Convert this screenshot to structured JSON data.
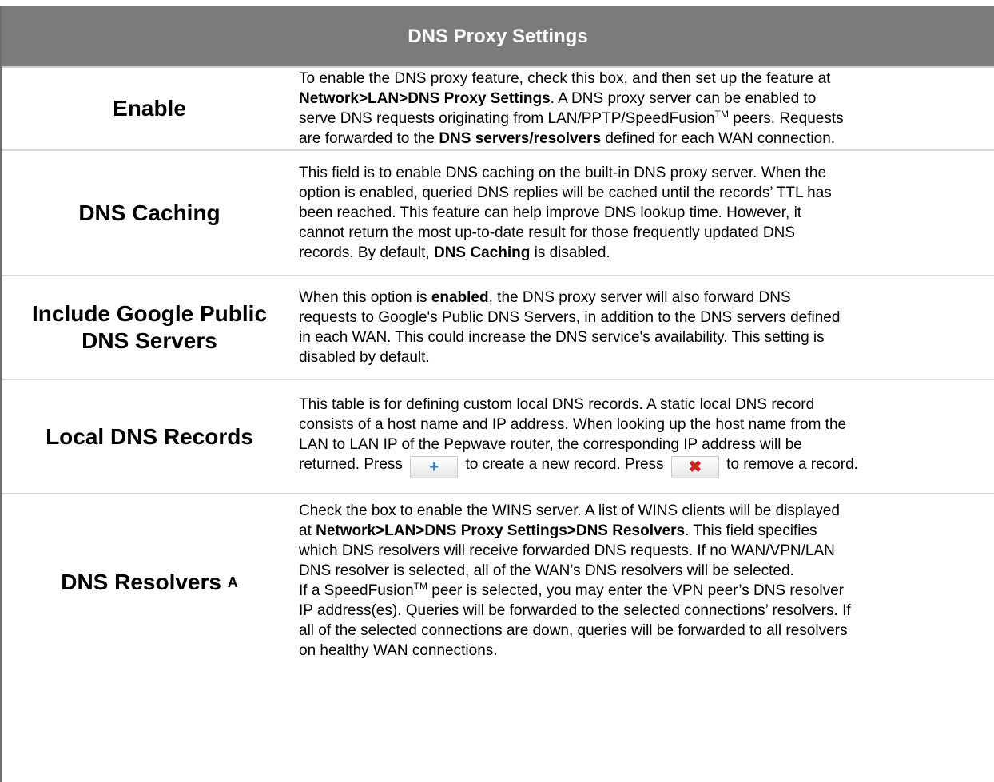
{
  "title": "DNS Proxy Settings",
  "rows": [
    {
      "label": "Enable",
      "lines": [
        [
          "To enable the DNS proxy feature, check this box, and then set up the feature at"
        ],
        [
          {
            "b": "Network>LAN>DNS Proxy Settings"
          },
          ". A DNS proxy server can be enabled to"
        ],
        [
          "serve DNS requests originating from LAN/PPTP/SpeedFusion",
          {
            "sup": "TM"
          },
          " peers. Requests"
        ],
        [
          "are forwarded to the ",
          {
            "b": "DNS servers/resolvers"
          },
          " defined for each WAN connection."
        ]
      ]
    },
    {
      "label": "DNS Caching",
      "lines": [
        [
          "This field is to enable DNS caching on the built-in DNS proxy server. When the"
        ],
        [
          "option is enabled, queried DNS replies will be cached until the records’ TTL has"
        ],
        [
          "been reached. This feature can help improve DNS lookup time. However, it"
        ],
        [
          "cannot return the most up-to-date result for those frequently updated DNS"
        ],
        [
          "records. By default, ",
          {
            "b": "DNS Caching"
          },
          " is disabled."
        ]
      ]
    },
    {
      "label": "Include Google Public DNS Servers",
      "lines": [
        [
          "When this option is ",
          {
            "b": "enabled"
          },
          ", the DNS proxy server will also forward DNS"
        ],
        [
          "requests to Google's Public DNS Servers, in addition to the DNS servers defined"
        ],
        [
          "in each WAN. This could increase the DNS service's availability. This setting is"
        ],
        [
          "disabled by default."
        ]
      ]
    },
    {
      "label": "Local DNS Records",
      "lines": [
        [
          "This table is for defining custom local DNS records. A static local DNS record"
        ],
        [
          "consists of a host name and IP address. When looking up the host name from the"
        ],
        [
          "LAN to LAN IP of the Pepwave router, the corresponding IP address will be"
        ],
        [
          "returned. Press ",
          {
            "btn": "add",
            "glyph": "+"
          },
          " to create a new record. Press ",
          {
            "btn": "remove",
            "glyph": "✖"
          },
          " to remove a record."
        ]
      ]
    },
    {
      "label": "DNS Resolvers",
      "label_sup": "A",
      "lines": [
        [
          "Check the box to enable the WINS server. A list of WINS clients will be displayed"
        ],
        [
          "at ",
          {
            "b": "Network>LAN>DNS Proxy Settings>DNS Resolvers"
          },
          ". This field specifies"
        ],
        [
          "which DNS resolvers will receive forwarded DNS requests. If no WAN/VPN/LAN"
        ],
        [
          "DNS resolver is selected, all of the WAN’s DNS resolvers will be selected."
        ],
        [
          "If a SpeedFusion",
          {
            "sup": "TM"
          },
          " peer is selected, you may enter the VPN peer’s DNS resolver"
        ],
        [
          "IP address(es). Queries will be forwarded to the selected connections’ resolvers. If"
        ],
        [
          "all of the selected connections are down, queries will be forwarded to all resolvers"
        ],
        [
          "on healthy WAN connections."
        ]
      ]
    }
  ]
}
